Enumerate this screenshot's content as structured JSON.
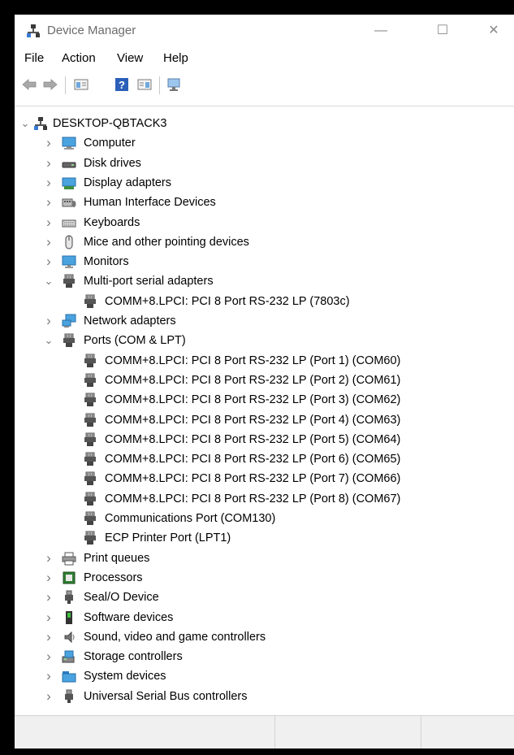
{
  "window": {
    "title": "Device Manager",
    "controls": {
      "minimize": "—",
      "maximize": "☐",
      "close": "✕"
    }
  },
  "menu": [
    "File",
    "Action",
    "View",
    "Help"
  ],
  "toolbar": [
    "back-icon",
    "forward-icon",
    "properties-icon",
    "help-icon",
    "show-hidden-icon",
    "scan-hardware-icon"
  ],
  "tree": {
    "root": {
      "label": "DESKTOP-QBTACK3",
      "icon": "computer-network-icon",
      "expanded": true
    },
    "categories": [
      {
        "label": "Computer",
        "icon": "computer-icon",
        "expanded": false
      },
      {
        "label": "Disk drives",
        "icon": "disk-drive-icon",
        "expanded": false
      },
      {
        "label": "Display adapters",
        "icon": "display-adapter-icon",
        "expanded": false
      },
      {
        "label": "Human Interface Devices",
        "icon": "hid-icon",
        "expanded": false
      },
      {
        "label": "Keyboards",
        "icon": "keyboard-icon",
        "expanded": false
      },
      {
        "label": "Mice and other pointing devices",
        "icon": "mouse-icon",
        "expanded": false
      },
      {
        "label": "Monitors",
        "icon": "monitor-icon",
        "expanded": false
      },
      {
        "label": "Multi-port serial adapters",
        "icon": "port-icon",
        "expanded": true,
        "children": [
          "COMM+8.LPCI: PCI 8 Port RS-232 LP (7803c)"
        ]
      },
      {
        "label": "Network adapters",
        "icon": "network-adapter-icon",
        "expanded": false
      },
      {
        "label": "Ports (COM & LPT)",
        "icon": "port-icon",
        "expanded": true,
        "children": [
          "COMM+8.LPCI: PCI 8 Port RS-232 LP (Port 1) (COM60)",
          "COMM+8.LPCI: PCI 8 Port RS-232 LP (Port 2) (COM61)",
          "COMM+8.LPCI: PCI 8 Port RS-232 LP (Port 3) (COM62)",
          "COMM+8.LPCI: PCI 8 Port RS-232 LP (Port 4) (COM63)",
          "COMM+8.LPCI: PCI 8 Port RS-232 LP (Port 5) (COM64)",
          "COMM+8.LPCI: PCI 8 Port RS-232 LP (Port 6) (COM65)",
          "COMM+8.LPCI: PCI 8 Port RS-232 LP (Port 7) (COM66)",
          "COMM+8.LPCI: PCI 8 Port RS-232 LP (Port 8) (COM67)",
          "Communications Port (COM130)",
          "ECP Printer Port (LPT1)"
        ]
      },
      {
        "label": "Print queues",
        "icon": "printer-icon",
        "expanded": false
      },
      {
        "label": "Processors",
        "icon": "processor-icon",
        "expanded": false
      },
      {
        "label": "Seal/O Device",
        "icon": "usb-plug-icon",
        "expanded": false
      },
      {
        "label": "Software devices",
        "icon": "software-device-icon",
        "expanded": false
      },
      {
        "label": "Sound, video and game controllers",
        "icon": "speaker-icon",
        "expanded": false
      },
      {
        "label": "Storage controllers",
        "icon": "storage-controller-icon",
        "expanded": false
      },
      {
        "label": "System devices",
        "icon": "system-folder-icon",
        "expanded": false
      },
      {
        "label": "Universal Serial Bus controllers",
        "icon": "usb-plug-icon",
        "expanded": false
      }
    ]
  }
}
